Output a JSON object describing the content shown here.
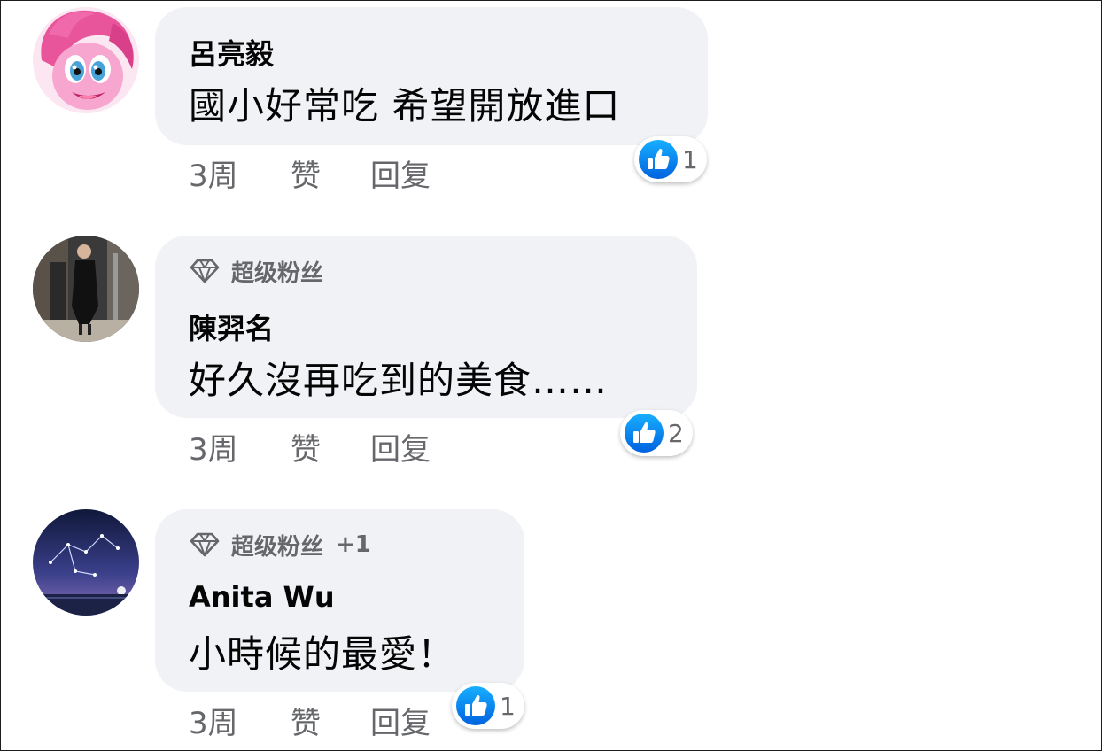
{
  "comments": [
    {
      "author": "呂亮毅",
      "badge": "",
      "badge_extra": "",
      "text": "國小好常吃 希望開放進口",
      "time": "3周",
      "like_label": "赞",
      "reply_label": "回复",
      "reaction_count": "1",
      "avatar": "pony-avatar"
    },
    {
      "author": "陳羿名",
      "badge": "超级粉丝",
      "badge_extra": "",
      "text": "好久沒再吃到的美食……",
      "time": "3周",
      "like_label": "赞",
      "reply_label": "回复",
      "reaction_count": "2",
      "avatar": "person-photo-avatar"
    },
    {
      "author": "Anita Wu",
      "badge": "超级粉丝",
      "badge_extra": "+1",
      "text": "小時候的最愛！",
      "time": "3周",
      "like_label": "赞",
      "reply_label": "回复",
      "reaction_count": "1",
      "avatar": "constellation-avatar"
    }
  ],
  "colors": {
    "bubble": "#f0f2f5",
    "meta_text": "#65676b",
    "like_blue": "#1877f2"
  }
}
